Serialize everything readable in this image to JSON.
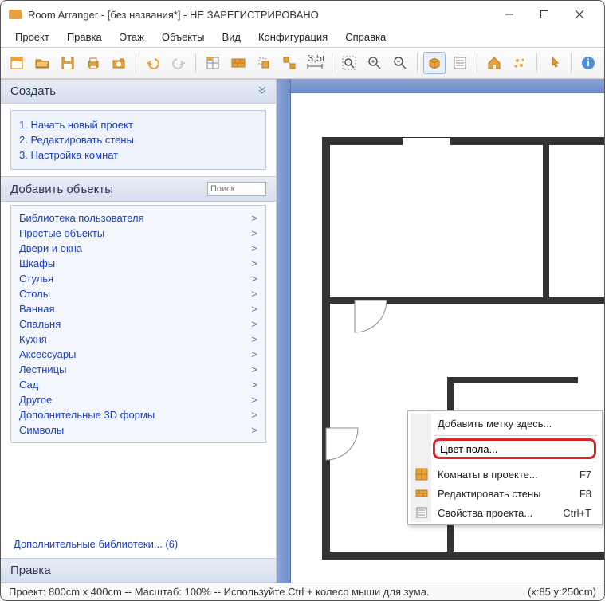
{
  "title": "Room Arranger - [без названия*] - НЕ ЗАРЕГИСТРИРОВАНО",
  "menu": [
    "Проект",
    "Правка",
    "Этаж",
    "Объекты",
    "Вид",
    "Конфигурация",
    "Справка"
  ],
  "sidebar": {
    "create": {
      "title": "Создать",
      "items": [
        "1. Начать новый проект",
        "2. Редактировать стены",
        "3. Настройка комнат"
      ]
    },
    "addobjects": {
      "title": "Добавить объекты",
      "search_placeholder": "Поиск",
      "categories": [
        "Библиотека пользователя",
        "Простые объекты",
        "Двери и окна",
        "Шкафы",
        "Стулья",
        "Столы",
        "Ванная",
        "Спальня",
        "Кухня",
        "Аксессуары",
        "Лестницы",
        "Сад",
        "Другое",
        "Дополнительные 3D формы",
        "Символы"
      ],
      "extra_libs": "Дополнительные библиотеки... (6)"
    },
    "edit": {
      "title": "Правка"
    }
  },
  "contextmenu": {
    "add_label": "Добавить метку здесь...",
    "floor_color": "Цвет пола...",
    "rooms_project": "Комнаты в проекте...",
    "rooms_shortcut": "F7",
    "edit_walls": "Редактировать стены",
    "edit_walls_shortcut": "F8",
    "project_props": "Свойства проекта...",
    "project_props_shortcut": "Ctrl+T"
  },
  "status": {
    "left": "Проект: 800cm x 400cm -- Масштаб: 100% -- Используйте Ctrl + колесо мыши для зума.",
    "right": "(x:85 y:250cm)"
  }
}
